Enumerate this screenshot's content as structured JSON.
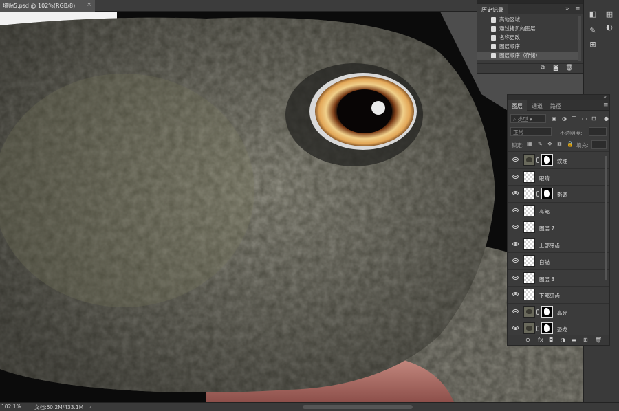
{
  "document_tab": {
    "title": "墙贴5.psd @ 102%(RGB/8)",
    "close": "×"
  },
  "status": {
    "zoom": "102.1%",
    "doc_info": "文档:60.2M/433.1M",
    "arrow": "›"
  },
  "history": {
    "tab": "历史记录",
    "collapse": "»",
    "menu": "≡",
    "items": [
      {
        "label": "高地区域"
      },
      {
        "label": "通过拷贝的图层"
      },
      {
        "label": "名称更改"
      },
      {
        "label": "图层顺序"
      },
      {
        "label": "图层顺序（存储）"
      }
    ],
    "footer_icons": [
      "new-snapshot-icon",
      "camera-icon",
      "trash-icon"
    ]
  },
  "layers": {
    "tabs": [
      "图层",
      "通道",
      "路径"
    ],
    "menu": "≡",
    "collapse": "»",
    "filter_kind": "类型",
    "blend_mode": "正常",
    "opacity_label": "不透明度:",
    "lock_label": "锁定:",
    "fill_label": "填充:",
    "items": [
      {
        "name": "纹理",
        "type": "image-mask"
      },
      {
        "name": "眼睛",
        "type": "plain"
      },
      {
        "name": "影调",
        "type": "plain-mask"
      },
      {
        "name": "亮部",
        "type": "plain"
      },
      {
        "name": "图层 7",
        "type": "plain"
      },
      {
        "name": "上部牙齿",
        "type": "plain"
      },
      {
        "name": "白描",
        "type": "plain"
      },
      {
        "name": "图层 3",
        "type": "plain"
      },
      {
        "name": "下部牙齿",
        "type": "plain"
      },
      {
        "name": "高光",
        "type": "image-mask"
      },
      {
        "name": "恐龙",
        "type": "image-mask"
      }
    ],
    "footer_icons": [
      "link-icon",
      "fx-icon",
      "mask-icon",
      "adjustment-icon",
      "folder-icon",
      "new-layer-icon",
      "trash-icon"
    ]
  },
  "colors": {
    "ui_bg": "#282828",
    "panel": "#3b3b3b",
    "skin": "#5b5a4e",
    "iris": "#e8b86a",
    "gum": "#b06f67"
  }
}
